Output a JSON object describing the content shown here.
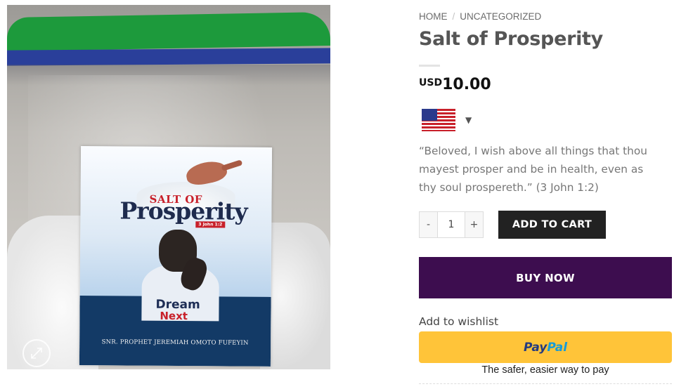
{
  "product": {
    "image": {
      "label_heading_small": "SALT OF",
      "label_heading_large": "Prosperity",
      "label_verse": "3 John 1:2",
      "label_shirt_line1": "Dream",
      "label_shirt_line2": "Next",
      "label_footer": "SNR. PROPHET JEREMIAH OMOTO FUFEYIN",
      "zoom_icon": "expand-icon"
    }
  },
  "breadcrumb": {
    "home": "HOME",
    "separator": "/",
    "category": "UNCATEGORIZED"
  },
  "title": "Salt of Prosperity",
  "price": {
    "currency": "USD",
    "amount": "10.00"
  },
  "currency_switcher": {
    "flag_icon": "us-flag-icon",
    "caret": "▼"
  },
  "description": "“Beloved, I wish above all things that thou mayest prosper and be in health, even as thy soul prospereth.” (3 John 1:2)",
  "quantity": {
    "minus": "-",
    "value": "1",
    "plus": "+"
  },
  "buttons": {
    "add_to_cart": "ADD TO CART",
    "buy_now": "BUY NOW",
    "wishlist": "Add to wishlist",
    "paypal_pay": "Pay",
    "paypal_pal": "Pal",
    "paypal_tagline": "The safer, easier way to pay"
  },
  "colors": {
    "buy_now": "#3d0d4f",
    "add_to_cart": "#222222",
    "paypal_button": "#ffc439"
  }
}
